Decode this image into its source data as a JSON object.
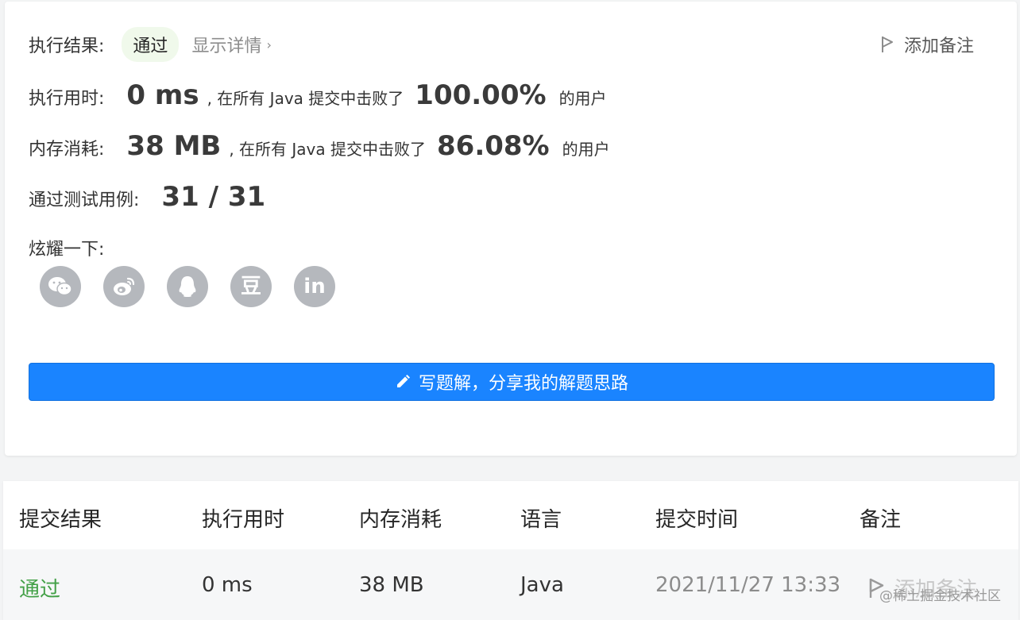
{
  "result": {
    "label": "执行结果:",
    "status": "通过",
    "details_link": "显示详情",
    "add_note": "添加备注"
  },
  "runtime": {
    "label": "执行用时:",
    "value": "0 ms",
    "beat_prefix": ", 在所有 Java 提交中击败了",
    "percent": "100.00%",
    "suffix": "的用户"
  },
  "memory": {
    "label": "内存消耗:",
    "value": "38 MB",
    "beat_prefix": ", 在所有 Java 提交中击败了",
    "percent": "86.08%",
    "suffix": "的用户"
  },
  "testcases": {
    "label": "通过测试用例:",
    "value": "31 / 31"
  },
  "share": {
    "label": "炫耀一下:",
    "icons": [
      "wechat-icon",
      "weibo-icon",
      "qq-icon",
      "douban-icon",
      "linkedin-icon"
    ],
    "douban_glyph": "豆",
    "linkedin_glyph": "in"
  },
  "write_solution": {
    "label": "写题解，分享我的解题思路"
  },
  "table": {
    "headers": [
      "提交结果",
      "执行用时",
      "内存消耗",
      "语言",
      "提交时间",
      "备注"
    ],
    "row": {
      "status": "通过",
      "runtime": "0 ms",
      "memory": "38 MB",
      "language": "Java",
      "time": "2021/11/27 13:33",
      "note": "添加备注"
    }
  },
  "watermark": "@稀土掘金技术社区",
  "colors": {
    "accent": "#1a84ff",
    "pass_green": "#43a047",
    "badge_bg": "#f0f9eb",
    "share_icon_bg": "#b5b8bd"
  }
}
